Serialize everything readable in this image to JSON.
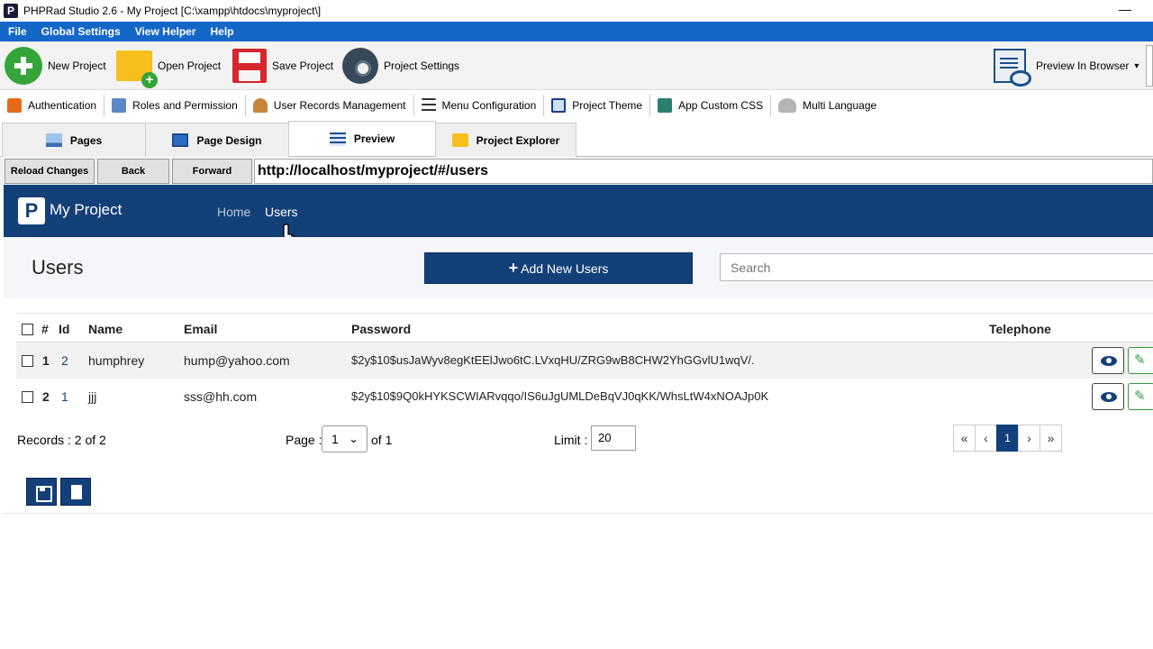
{
  "window": {
    "title": "PHPRad Studio 2.6 - My Project [C:\\xampp\\htdocs\\myproject\\]",
    "minimize": "—"
  },
  "menu": [
    "File",
    "Global Settings",
    "View Helper",
    "Help"
  ],
  "toolbar": {
    "new_project": "New Project",
    "open_project": "Open Project",
    "save_project": "Save Project",
    "project_settings": "Project Settings",
    "preview_in_browser": "Preview In Browser",
    "caret": "▾"
  },
  "toolbar2": [
    "Authentication",
    "Roles and Permission",
    "User Records Management",
    "Menu Configuration",
    "Project Theme",
    "App Custom CSS",
    "Multi Language"
  ],
  "tabs": [
    "Pages",
    "Page Design",
    "Preview",
    "Project Explorer"
  ],
  "browser": {
    "reload": "Reload Changes",
    "back": "Back",
    "forward": "Forward",
    "url": "http://localhost/myproject/#/users"
  },
  "site": {
    "logo_letter": "P",
    "brand": "My Project",
    "nav": [
      "Home",
      "Users"
    ],
    "page_title": "Users",
    "add_button": "Add New Users",
    "add_plus": "+",
    "search_placeholder": "Search"
  },
  "table": {
    "headers": {
      "num": "#",
      "id": "Id",
      "name": "Name",
      "email": "Email",
      "password": "Password",
      "telephone": "Telephone"
    },
    "rows": [
      {
        "num": "1",
        "id": "2",
        "name": "humphrey",
        "email": "hump@yahoo.com",
        "password": "$2y$10$usJaWyv8egKtEElJwo6tC.LVxqHU/ZRG9wB8CHW2YhGGvlU1wqV/.",
        "telephone": ""
      },
      {
        "num": "2",
        "id": "1",
        "name": "jjj",
        "email": "sss@hh.com",
        "password": "$2y$10$9Q0kHYKSCWIARvqqo/IS6uJgUMLDeBqVJ0qKK/WhsLtW4xNOAJp0K",
        "telephone": ""
      }
    ],
    "edit_glyph": "✎"
  },
  "pagination": {
    "records": "Records : 2 of 2",
    "page_label": "Page :",
    "page_value": "1",
    "page_chev": "⌄",
    "of_label": "of 1",
    "limit_label": "Limit :",
    "limit_value": "20",
    "first": "«",
    "prev": "‹",
    "current": "1",
    "next": "›",
    "last": "»"
  },
  "colors": {
    "menubar": "#1467c7",
    "site_header": "#144079",
    "accent_green": "#35a53a"
  }
}
